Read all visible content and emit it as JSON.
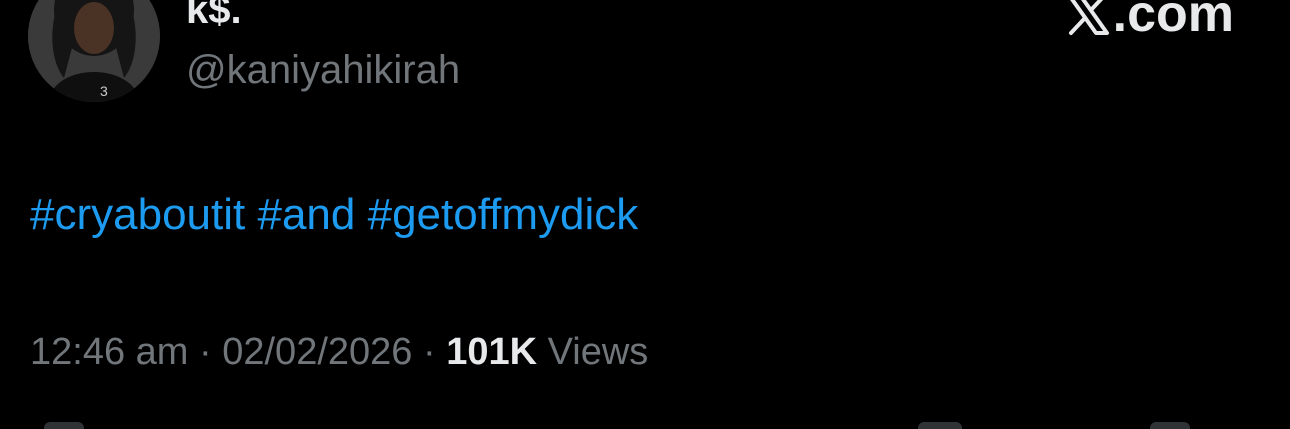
{
  "author": {
    "display_name": "k$.",
    "handle": "@kaniyahikirah"
  },
  "source": {
    "label": ".com",
    "icon": "x-logo-icon"
  },
  "tweet": {
    "hashtags": [
      "#cryaboutit",
      "#and",
      "#getoffmydick"
    ]
  },
  "meta": {
    "time": "12:46 am",
    "separator": "·",
    "date": "02/02/2026",
    "views_count": "101K",
    "views_label": "Views"
  },
  "colors": {
    "background": "#000000",
    "link": "#1d9bf0",
    "secondary_text": "#71767b",
    "primary_text": "#e7e9ea"
  }
}
